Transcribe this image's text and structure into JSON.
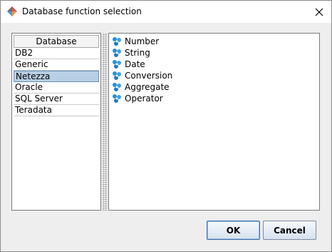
{
  "window": {
    "title": "Database function selection",
    "icons": {
      "app": "app-logo-icon",
      "close": "close-icon"
    }
  },
  "database_list": {
    "header": "Database",
    "items": [
      "DB2",
      "Generic",
      "Netezza",
      "Oracle",
      "SQL Server",
      "Teradata"
    ],
    "selected": "Netezza"
  },
  "function_tree": {
    "icon": "gear-cluster-icon",
    "items": [
      "Number",
      "String",
      "Date",
      "Conversion",
      "Aggregate",
      "Operator"
    ]
  },
  "buttons": {
    "ok_label": "OK",
    "cancel_label": "Cancel"
  },
  "colors": {
    "selection": "#b8cfe5",
    "icon_blue": "#2a8fd6"
  }
}
